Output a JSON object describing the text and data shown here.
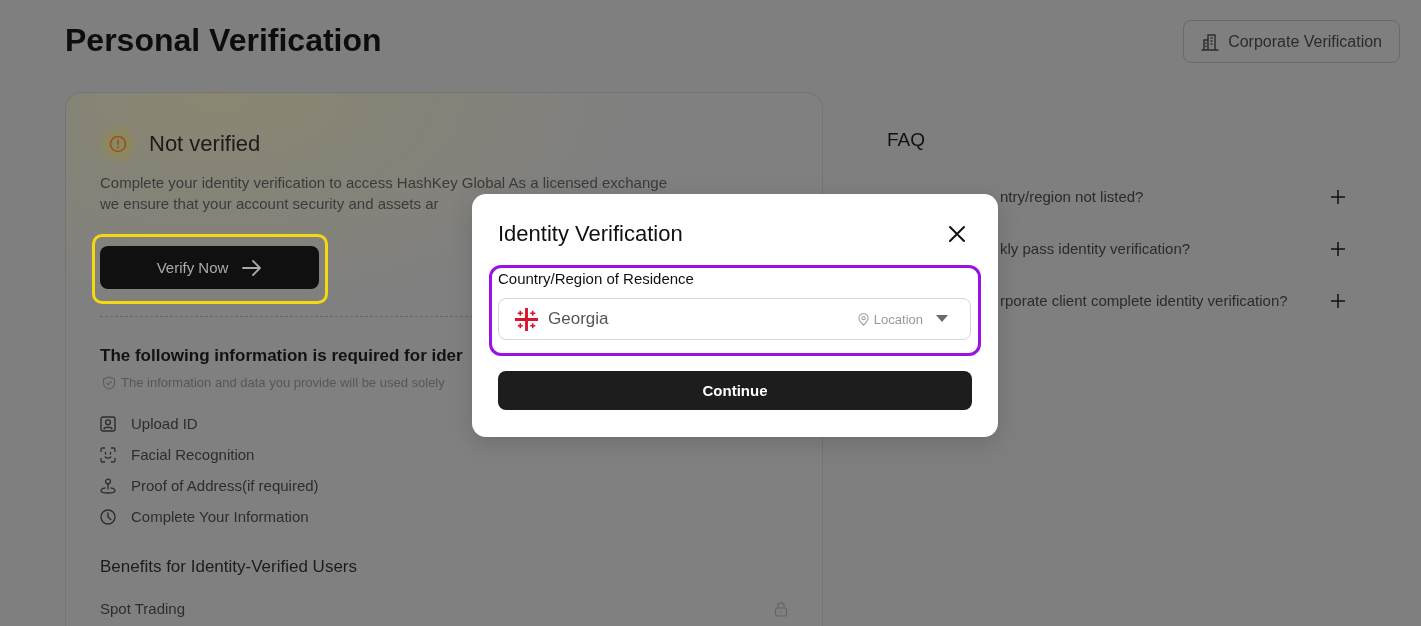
{
  "header": {
    "title": "Personal Verification",
    "corporate_button": "Corporate Verification"
  },
  "status_card": {
    "status": "Not verified",
    "description": [
      "Complete your identity verification to access HashKey Global As a licensed exchange",
      "we ensure that your account security and assets ar"
    ],
    "verify_button": {
      "label": "Verify Now",
      "highlighted": true
    },
    "requirements": {
      "title": "The following information is required for ider",
      "note": "The information and data you provide will be used solely",
      "items": [
        {
          "kind": "id",
          "label": "Upload ID"
        },
        {
          "kind": "face",
          "label": "Facial Recognition"
        },
        {
          "kind": "address",
          "label": "Proof of Address(if required)"
        },
        {
          "kind": "info",
          "label": "Complete Your Information"
        }
      ]
    },
    "benefits": {
      "title": "Benefits for Identity-Verified Users",
      "items": [
        {
          "label": "Spot Trading",
          "locked": true
        }
      ]
    }
  },
  "faq": {
    "title": "FAQ",
    "items": [
      {
        "question": "ntry/region not listed?",
        "expanded": false
      },
      {
        "question": "kly pass identity verification?",
        "expanded": false
      },
      {
        "question": "rporate client complete identity verification?",
        "expanded": false
      }
    ]
  },
  "modal": {
    "title": "Identity Verification",
    "field": {
      "label": "Country/Region of Residence",
      "value": "Georgia",
      "location_hint": "Location",
      "highlighted": true
    },
    "continue_button": "Continue"
  }
}
